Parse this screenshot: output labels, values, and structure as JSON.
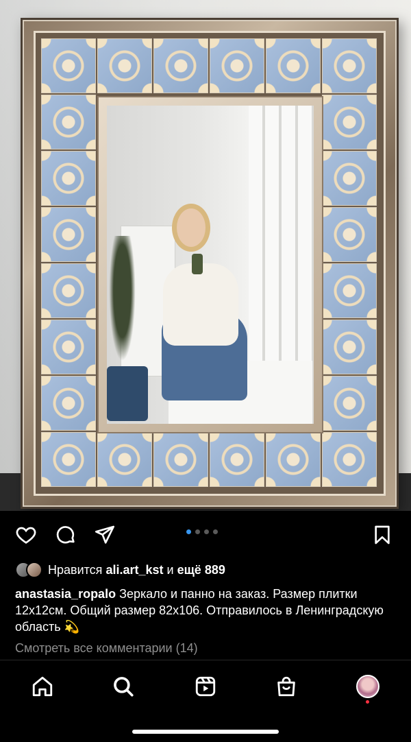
{
  "post": {
    "image_alt": "photo",
    "carousel": {
      "count": 4,
      "active_index": 0
    },
    "actions": {
      "like_icon": "heart-icon",
      "comment_icon": "comment-icon",
      "share_icon": "send-icon",
      "save_icon": "bookmark-icon"
    },
    "likes": {
      "prefix": "Нравится",
      "user": "ali.art_kst",
      "joiner": "и",
      "rest": "ещё 889"
    },
    "caption": {
      "username": "anastasia_ropalo",
      "text": "Зеркало и панно на заказ. Размер плитки 12х12см. Общий размер 82х106. Отправилось в Ленинградскую область 💫"
    },
    "view_comments": "Смотреть все комментарии (14)"
  },
  "nav": {
    "items": [
      {
        "name": "home",
        "icon": "home-icon"
      },
      {
        "name": "search",
        "icon": "search-icon"
      },
      {
        "name": "reels",
        "icon": "reels-icon"
      },
      {
        "name": "shop",
        "icon": "shop-icon"
      },
      {
        "name": "profile",
        "icon": "profile-avatar"
      }
    ]
  },
  "colors": {
    "background": "#000000",
    "text": "#ffffff",
    "muted": "#8e8e8e",
    "carousel_active": "#3897f0",
    "notification": "#ff3040",
    "tile_blue": "#9fb7d6",
    "tile_cream": "#f2e3c4"
  }
}
